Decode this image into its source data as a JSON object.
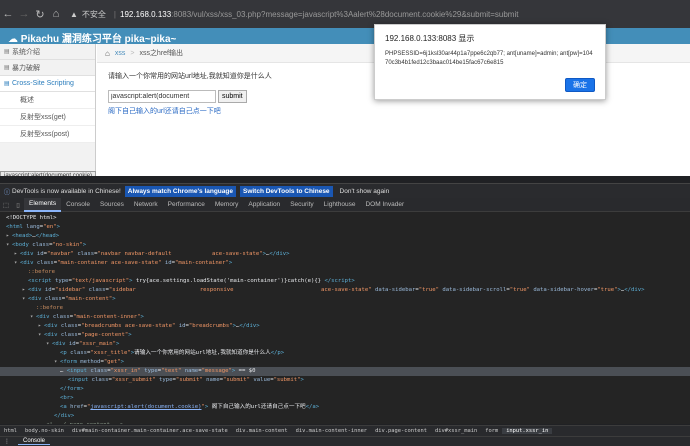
{
  "browser": {
    "security_label": "不安全",
    "url_host": "192.168.0.133",
    "url_rest": ":8083/vul/xss/xss_03.php?message=javascript%3Aalert%28document.cookie%29&submit=submit"
  },
  "page": {
    "brand": "Pikachu 漏洞练习平台 pika~pika~",
    "sidebar": {
      "items": [
        {
          "label": "系统介绍"
        },
        {
          "label": "暴力破解"
        },
        {
          "label": "Cross-Site Scripting"
        }
      ],
      "sub_items": [
        {
          "label": "概述"
        },
        {
          "label": "反射型xss(get)"
        },
        {
          "label": "反射型xss(post)"
        }
      ]
    },
    "breadcrumb": {
      "first": "xss",
      "second": "xss之href输出"
    },
    "prompt": "请输入一个你常用的网站url地址,我就知道你是什么人",
    "input_value": "javascript:alert(document",
    "submit_label": "submit",
    "result_link": "阁下自己输入的url还请自己点一下吧",
    "tooltip": "javascript:alert(document.cookie)"
  },
  "dialog": {
    "title": "192.168.0.133:8083 显示",
    "message": "PHPSESSID=6j1ksl30ar44p1a7ppe6c2qb77; ant[uname]=admin; ant[pw]=10470c3b4b1fed12c3baac014be15fac67c6e815",
    "ok_label": "确定"
  },
  "infobar": {
    "message": "DevTools is now available in Chinese!",
    "btn_match": "Always match Chrome's language",
    "btn_switch": "Switch DevTools to Chinese",
    "btn_dont": "Don't show again"
  },
  "devtools": {
    "tabs": [
      {
        "label": "Elements"
      },
      {
        "label": "Console"
      },
      {
        "label": "Sources"
      },
      {
        "label": "Network"
      },
      {
        "label": "Performance"
      },
      {
        "label": "Memory"
      },
      {
        "label": "Application"
      },
      {
        "label": "Security"
      },
      {
        "label": "Lighthouse"
      },
      {
        "label": "DOM Invader"
      }
    ],
    "crumbs": [
      {
        "label": "html"
      },
      {
        "label": "body.no-skin"
      },
      {
        "label": "div#main-container.main-container.ace-save-state"
      },
      {
        "label": "div.main-content"
      },
      {
        "label": "div.main-content-inner"
      },
      {
        "label": "div.page-content"
      },
      {
        "label": "div#xssr_main"
      },
      {
        "label": "form"
      },
      {
        "label": "input.xssr_in"
      }
    ],
    "drawer_tab": "Console"
  },
  "colors": {
    "navbar": "#438eb9",
    "accent": "#1a73e8",
    "tag": "#5db0d7",
    "attr_value": "#f29766"
  }
}
